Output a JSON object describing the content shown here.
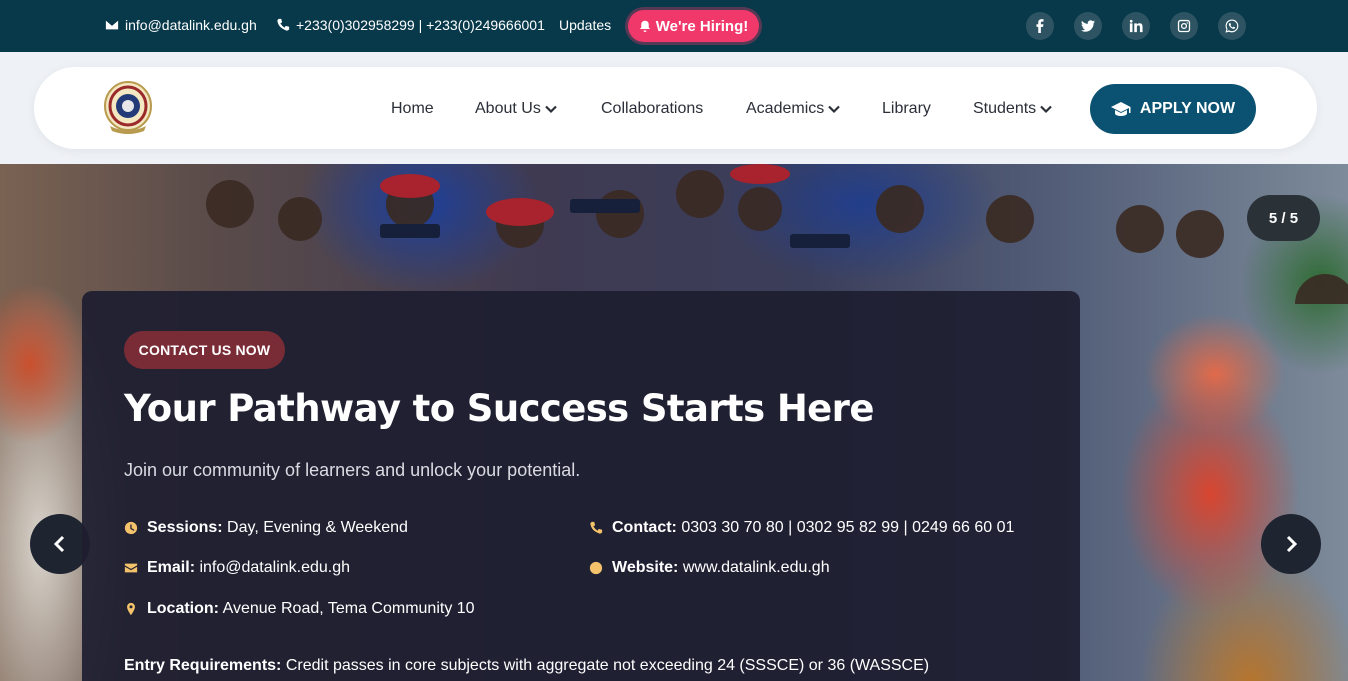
{
  "topbar": {
    "email": "info@datalink.edu.gh",
    "phones": "+233(0)302958299 | +233(0)249666001",
    "updates": "Updates",
    "hiring": "We're Hiring!",
    "socials": [
      "facebook-icon",
      "twitter-icon",
      "linkedin-icon",
      "instagram-icon",
      "whatsapp-icon"
    ]
  },
  "nav": {
    "items": [
      {
        "label": "Home",
        "dropdown": false
      },
      {
        "label": "About Us",
        "dropdown": true
      },
      {
        "label": "Collaborations",
        "dropdown": false
      },
      {
        "label": "Academics",
        "dropdown": true
      },
      {
        "label": "Library",
        "dropdown": false
      },
      {
        "label": "Students",
        "dropdown": true
      }
    ],
    "apply": "APPLY NOW"
  },
  "hero": {
    "slide_counter": "5 / 5",
    "contact_button": "CONTACT US NOW",
    "headline": "Your Pathway to Success Starts Here",
    "subtitle": "Join our community of learners and unlock your potential.",
    "sessions": {
      "label": "Sessions:",
      "value": "Day, Evening & Weekend"
    },
    "contact": {
      "label": "Contact:",
      "value": "0303 30 70 80 | 0302 95 82 99 | 0249 66 60 01"
    },
    "email": {
      "label": "Email:",
      "value": "info@datalink.edu.gh"
    },
    "website": {
      "label": "Website:",
      "value": "www.datalink.edu.gh"
    },
    "location": {
      "label": "Location:",
      "value": "Avenue Road, Tema Community 10"
    },
    "entry": {
      "label": "Entry Requirements:",
      "value": "Credit passes in core subjects with aggregate not exceeding 24 (SSSCE) or 36 (WASSCE)"
    }
  },
  "colors": {
    "topbar_bg": "#07394a",
    "accent": "#0b5272",
    "hiring": "#f0386b",
    "contact_button": "#7a2c36",
    "info_icon": "#f3c26a"
  }
}
